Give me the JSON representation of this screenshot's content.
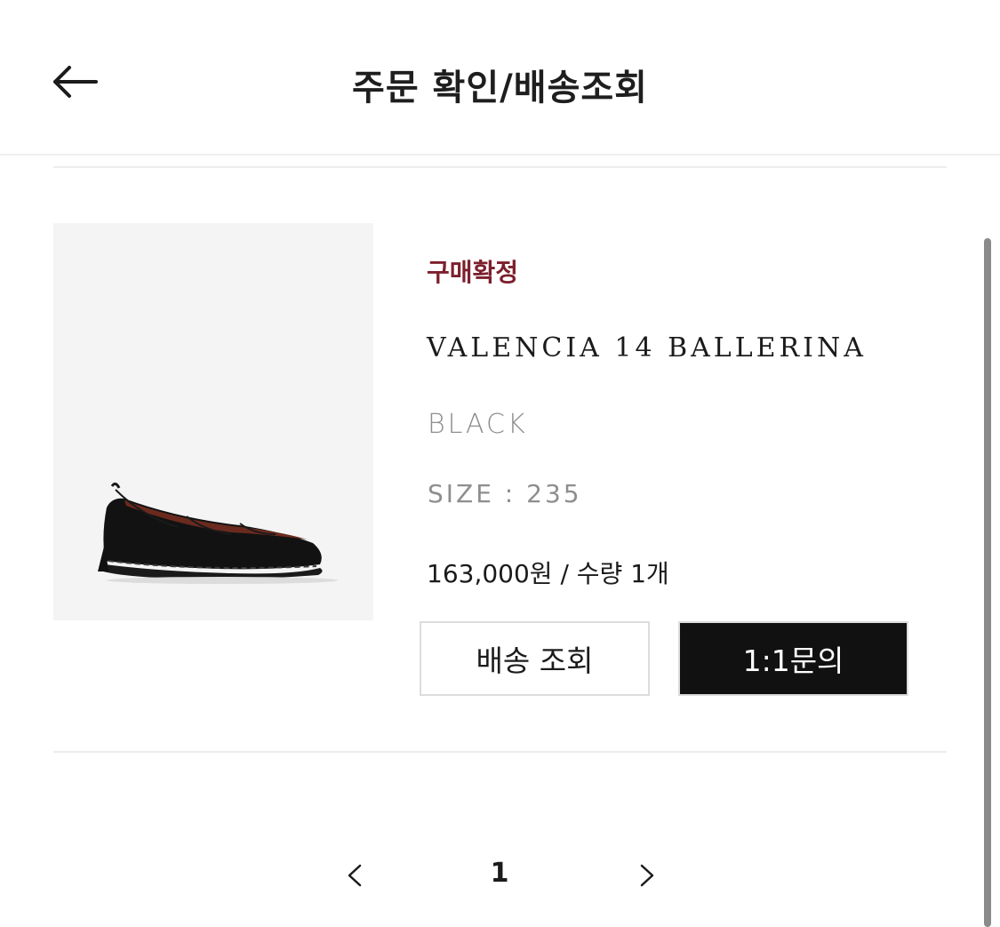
{
  "header": {
    "title": "주문 확인/배송조회",
    "back_icon": "arrow-left-icon"
  },
  "order": {
    "status": "구매확정",
    "status_color": "#7c1f2c",
    "product_name": "VALENCIA 14 BALLERINA",
    "color": "BLACK",
    "size": "SIZE : 235",
    "price_quantity": "163,000원 / 수량 1개",
    "image_alt": "black leather ballerina flat"
  },
  "actions": {
    "track_label": "배송 조회",
    "inquiry_label": "1:1문의"
  },
  "pagination": {
    "prev_icon": "chevron-left-icon",
    "current": "1",
    "next_icon": "chevron-right-icon"
  }
}
